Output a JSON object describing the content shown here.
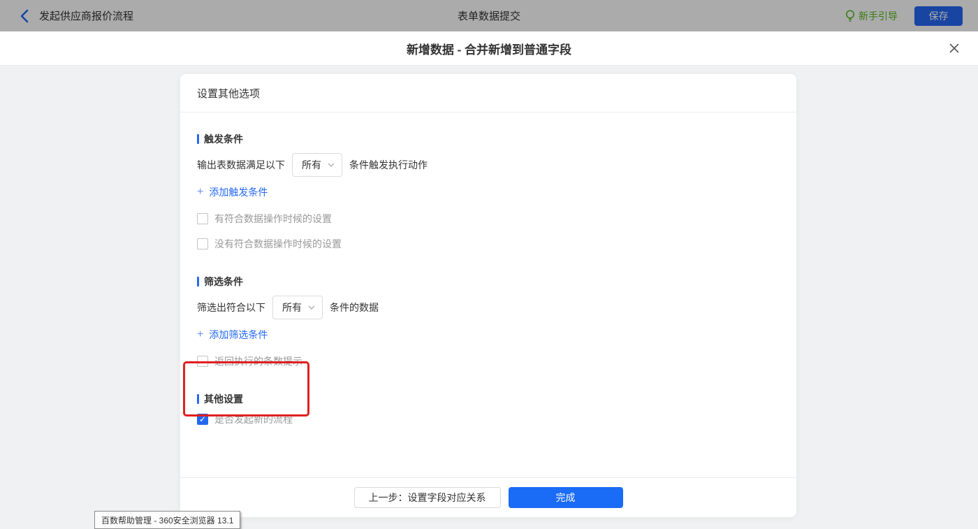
{
  "colors": {
    "accent": "#2468f2",
    "done_blue": "#1a6bf5",
    "guide_green": "#52b81a",
    "annotation_red": "#e02020",
    "dim_overlay": "rgba(0,0,0,0.33)"
  },
  "topbar": {
    "back_label": "发起供应商报价流程",
    "center_title": "表单数据提交",
    "guide_label": "新手引导",
    "save_label": "保存"
  },
  "modal": {
    "title": "新增数据 - 合并新增到普通字段"
  },
  "panel": {
    "header": "设置其他选项",
    "sections": [
      {
        "title": "触发条件",
        "row": {
          "prefix": "输出表数据满足以下",
          "select_value": "所有",
          "suffix": "条件触发执行动作"
        },
        "add_link": {
          "plus": "+",
          "label": "添加触发条件"
        },
        "checkboxes": [
          {
            "label": "有符合数据操作时候的设置",
            "checked": false
          },
          {
            "label": "没有符合数据操作时候的设置",
            "checked": false
          }
        ]
      },
      {
        "title": "筛选条件",
        "row": {
          "prefix": "筛选出符合以下",
          "select_value": "所有",
          "suffix": "条件的数据"
        },
        "add_link": {
          "plus": "+",
          "label": "添加筛选条件"
        },
        "checkboxes": [
          {
            "label": "返回执行的条数提示",
            "checked": false
          }
        ]
      },
      {
        "title": "其他设置",
        "checkboxes": [
          {
            "label": "是否发起新的流程",
            "checked": true,
            "checkmark": "✓"
          }
        ]
      }
    ],
    "footer": {
      "prev_label": "上一步：设置字段对应关系",
      "done_label": "完成"
    }
  },
  "browser_tooltip": "百数帮助管理 - 360安全浏览器 13.1"
}
